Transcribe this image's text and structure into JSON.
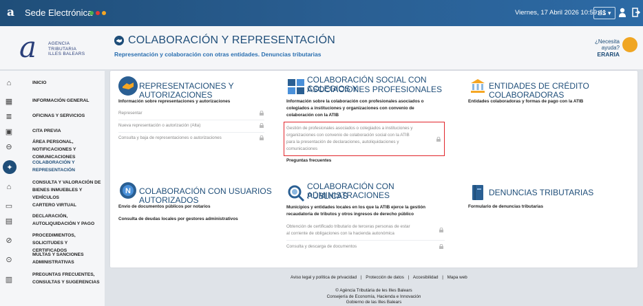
{
  "topbar": {
    "logo_mark": "a",
    "title": "Sede Electrónica",
    "datetime": "Viernes, 17 Abril 2026 10:59:41",
    "lang": "ES ▾",
    "colors": {
      "bg": "#1f4e79",
      "dots": [
        "#4caf50",
        "#e53935",
        "#f5a623"
      ]
    }
  },
  "header": {
    "logo_text": [
      "AGENCIA",
      "TRIBUTARIA",
      "ILLES BALEARS"
    ],
    "section_title": "COLABORACIÓN Y REPRESENTACIÓN",
    "section_subtitle": "Representación y colaboración con otras entidades. Denuncias tributarias",
    "help_question": "¿Necesita ayuda?",
    "help_name": "ERARIA"
  },
  "sidebar": {
    "items": [
      {
        "label": "INICIO",
        "icon": "home-icon"
      },
      {
        "label": "INFORMACIÓN GENERAL",
        "icon": "building-icon"
      },
      {
        "label": "OFICINAS Y SERVICIOS",
        "icon": "list-icon"
      },
      {
        "label": "CITA PREVIA",
        "icon": "calendar-icon"
      },
      {
        "label": "ÁREA PERSONAL, NOTIFICACIONES Y COMUNICACIONES",
        "icon": "user-circle-icon"
      },
      {
        "label": "COLABORACIÓN Y REPRESENTACIÓN",
        "icon": "handshake-icon"
      },
      {
        "label": "CONSULTA Y VALORACIÓN DE BIENES INMUEBLES Y VEHÍCULOS",
        "icon": "house-car-icon"
      },
      {
        "label": "CARTERO VIRTUAL",
        "icon": "laptop-icon"
      },
      {
        "label": "DECLARACIÓN, AUTOLIQUIDACIÓN Y PAGO",
        "icon": "document-icon"
      },
      {
        "label": "PROCEDIMIENTOS, SOLICITUDES Y CERTIFICADOS",
        "icon": "check-circle-icon"
      },
      {
        "label": "MULTAS Y SANCIONES ADMINISTRATIVAS",
        "icon": "shield-icon"
      },
      {
        "label": "PREGUNTAS FRECUENTES, CONSULTAS Y SUGERENCIAS",
        "icon": "chat-icon"
      }
    ],
    "active_index": 5
  },
  "cards": {
    "rep": {
      "title": "REPRESENTACIONES Y AUTORIZACIONES",
      "desc": "Información sobre representaciones y autorizaciones",
      "links": [
        "Representar",
        "Nueva representación o autorización (Alta)",
        "Consulta y baja de representaciones o autorizaciones"
      ]
    },
    "social": {
      "title_line1": "COLABORACIÓN SOCIAL CON COLEGIOS Y",
      "title_line2": "ASOCIACIONES PROFESIONALES",
      "desc": [
        "Información sobre la colaboración con profesionales asociados o",
        "colegiados a instituciones y organizaciones con convenio de",
        "colaboración con la ATIB"
      ],
      "link_lines": [
        "Gestión de profesionales asociados o colegiados a instituciones y",
        "organizaciones con convenio de colaboración social con la ATIB",
        "para la presentación de declaraciones, autoliquidaciones y",
        "comunicaciones"
      ],
      "faq": "Preguntas frecuentes"
    },
    "credit": {
      "title": "ENTIDADES DE CRÉDITO COLABORADORAS",
      "desc": "Entidades colaboradoras y formas de pago con la ATIB"
    },
    "users": {
      "title": "COLABORACIÓN CON USUARIOS AUTORIZADOS",
      "items": [
        "Envío de documentos públicos por notarios",
        "Consulta de deudas locales por gestores administrativos"
      ]
    },
    "admin": {
      "title_line1": "COLABORACIÓN CON ADMINISTRACIONES",
      "title_line2": "PÚBLICAS",
      "desc": [
        "Municipios y entidades locales en los que la ATIB ejerce la gestión",
        "recaudatoria de tributos y otros ingresos de derecho público"
      ],
      "link1": [
        "Obtención de certificado tributario de terceras personas de estar",
        "al corriente de obligaciones con la hacienda autonómica"
      ],
      "link2": "Consulta y descarga de documentos"
    },
    "denuncias": {
      "title": "DENUNCIAS TRIBUTARIAS",
      "desc": "Formulario de denuncias tributarias"
    }
  },
  "footer": {
    "links": [
      "Aviso legal y política de privacidad",
      "Protección de datos",
      "Accesibilidad",
      "Mapa web"
    ],
    "separator": "|",
    "copyright": [
      "© Agència Tributària de les Illes Balears",
      "Consejería de Economía, Hacienda e Innovación",
      "Gobierno de las Illes Balears"
    ]
  }
}
